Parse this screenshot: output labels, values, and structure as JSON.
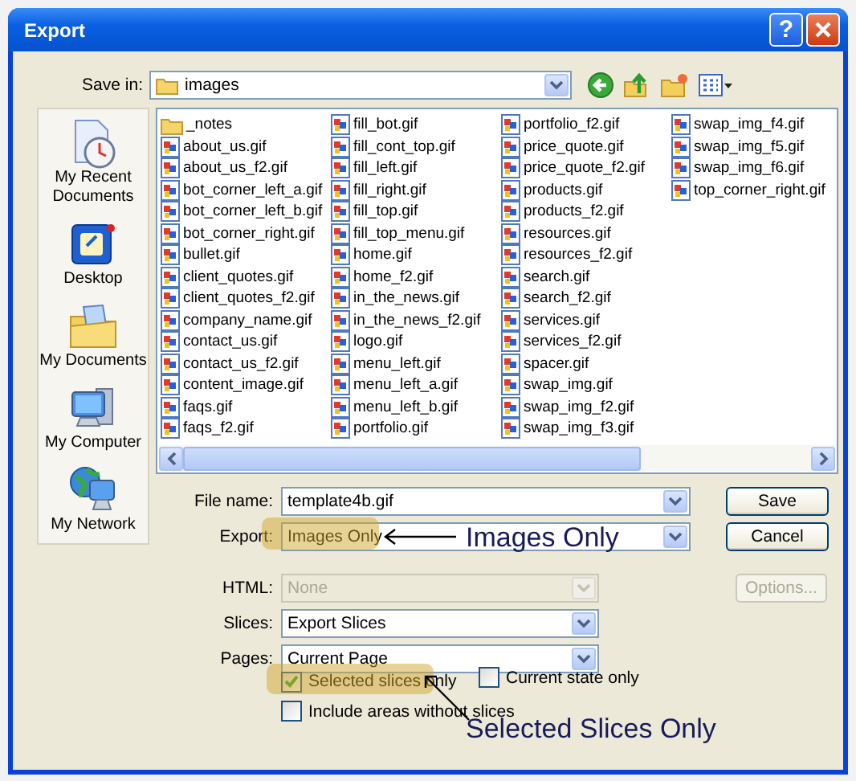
{
  "window": {
    "title": "Export",
    "help_button": "?"
  },
  "save_in": {
    "label": "Save in:",
    "value": "images"
  },
  "places": [
    {
      "label": "My Recent Documents",
      "kind": "recent"
    },
    {
      "label": "Desktop",
      "kind": "desktop"
    },
    {
      "label": "My Documents",
      "kind": "documents"
    },
    {
      "label": "My Computer",
      "kind": "computer"
    },
    {
      "label": "My Network",
      "kind": "network"
    }
  ],
  "files": [
    {
      "name": "_notes",
      "kind": "folder"
    },
    {
      "name": "about_us.gif",
      "kind": "image"
    },
    {
      "name": "about_us_f2.gif",
      "kind": "image"
    },
    {
      "name": "bot_corner_left_a.gif",
      "kind": "image"
    },
    {
      "name": "bot_corner_left_b.gif",
      "kind": "image"
    },
    {
      "name": "bot_corner_right.gif",
      "kind": "image"
    },
    {
      "name": "bullet.gif",
      "kind": "image"
    },
    {
      "name": "client_quotes.gif",
      "kind": "image"
    },
    {
      "name": "client_quotes_f2.gif",
      "kind": "image"
    },
    {
      "name": "company_name.gif",
      "kind": "image"
    },
    {
      "name": "contact_us.gif",
      "kind": "image"
    },
    {
      "name": "contact_us_f2.gif",
      "kind": "image"
    },
    {
      "name": "content_image.gif",
      "kind": "image"
    },
    {
      "name": "faqs.gif",
      "kind": "image"
    },
    {
      "name": "faqs_f2.gif",
      "kind": "image"
    },
    {
      "name": "fill_bot.gif",
      "kind": "image"
    },
    {
      "name": "fill_cont_top.gif",
      "kind": "image"
    },
    {
      "name": "fill_left.gif",
      "kind": "image"
    },
    {
      "name": "fill_right.gif",
      "kind": "image"
    },
    {
      "name": "fill_top.gif",
      "kind": "image"
    },
    {
      "name": "fill_top_menu.gif",
      "kind": "image"
    },
    {
      "name": "home.gif",
      "kind": "image"
    },
    {
      "name": "home_f2.gif",
      "kind": "image"
    },
    {
      "name": "in_the_news.gif",
      "kind": "image"
    },
    {
      "name": "in_the_news_f2.gif",
      "kind": "image"
    },
    {
      "name": "logo.gif",
      "kind": "image"
    },
    {
      "name": "menu_left.gif",
      "kind": "image"
    },
    {
      "name": "menu_left_a.gif",
      "kind": "image"
    },
    {
      "name": "menu_left_b.gif",
      "kind": "image"
    },
    {
      "name": "portfolio.gif",
      "kind": "image"
    },
    {
      "name": "portfolio_f2.gif",
      "kind": "image"
    },
    {
      "name": "price_quote.gif",
      "kind": "image"
    },
    {
      "name": "price_quote_f2.gif",
      "kind": "image"
    },
    {
      "name": "products.gif",
      "kind": "image"
    },
    {
      "name": "products_f2.gif",
      "kind": "image"
    },
    {
      "name": "resources.gif",
      "kind": "image"
    },
    {
      "name": "resources_f2.gif",
      "kind": "image"
    },
    {
      "name": "search.gif",
      "kind": "image"
    },
    {
      "name": "search_f2.gif",
      "kind": "image"
    },
    {
      "name": "services.gif",
      "kind": "image"
    },
    {
      "name": "services_f2.gif",
      "kind": "image"
    },
    {
      "name": "spacer.gif",
      "kind": "image"
    },
    {
      "name": "swap_img.gif",
      "kind": "image"
    },
    {
      "name": "swap_img_f2.gif",
      "kind": "image"
    },
    {
      "name": "swap_img_f3.gif",
      "kind": "image"
    },
    {
      "name": "swap_img_f4.gif",
      "kind": "image"
    },
    {
      "name": "swap_img_f5.gif",
      "kind": "image"
    },
    {
      "name": "swap_img_f6.gif",
      "kind": "image"
    },
    {
      "name": "top_corner_right.gif",
      "kind": "image"
    }
  ],
  "fields": [
    {
      "label": "File name:",
      "value": "template4b.gif",
      "disabled": false
    },
    {
      "label": "Export:",
      "value": "Images Only",
      "disabled": false
    },
    {
      "label": "HTML:",
      "value": "None",
      "disabled": true
    },
    {
      "label": "Slices:",
      "value": "Export Slices",
      "disabled": false
    },
    {
      "label": "Pages:",
      "value": "Current Page",
      "disabled": false
    }
  ],
  "buttons": [
    {
      "label": "Save",
      "disabled": false
    },
    {
      "label": "Cancel",
      "disabled": false
    },
    {
      "label": "Options...",
      "disabled": true
    }
  ],
  "checkboxes": [
    {
      "label": "Selected slices only",
      "checked": true
    },
    {
      "label": "Current state only",
      "checked": false
    },
    {
      "label": "Include areas without slices",
      "checked": false
    }
  ],
  "annotations": [
    {
      "text": "Images Only"
    },
    {
      "text": "Selected Slices Only"
    }
  ]
}
